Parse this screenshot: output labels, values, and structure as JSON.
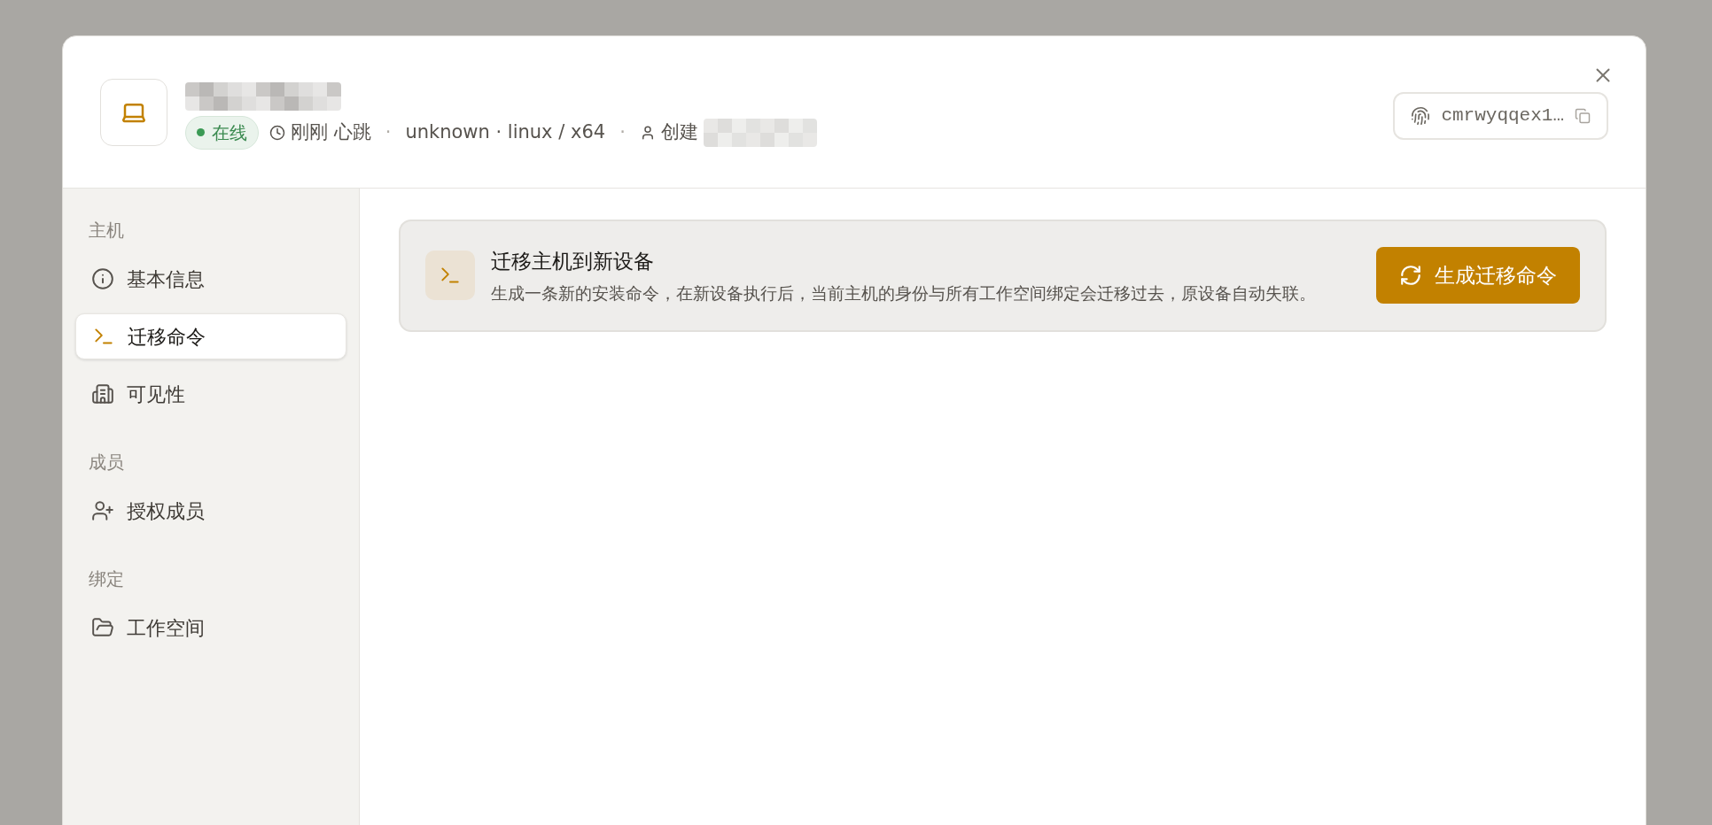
{
  "header": {
    "meta": [
      {
        "kind": "status",
        "text": "在线",
        "online": true
      },
      {
        "kind": "clock",
        "text": "刚刚 心跳"
      },
      {
        "kind": "sep",
        "text": "·"
      },
      {
        "kind": "plain",
        "text": "unknown · linux / x64"
      },
      {
        "kind": "sep",
        "text": "·"
      },
      {
        "kind": "user",
        "text": "创建"
      }
    ],
    "host_id": "cmrwyqqex1…"
  },
  "sidebar": {
    "groups": [
      {
        "label": "主机",
        "items": [
          {
            "kind": "info",
            "label": "基本信息",
            "selected": false
          },
          {
            "kind": "terminal",
            "label": "迁移命令",
            "selected": true
          },
          {
            "kind": "building",
            "label": "可见性",
            "selected": false
          }
        ]
      },
      {
        "label": "成员",
        "items": [
          {
            "kind": "user-plus",
            "label": "授权成员",
            "selected": false
          }
        ]
      },
      {
        "label": "绑定",
        "items": [
          {
            "kind": "folder",
            "label": "工作空间",
            "selected": false
          }
        ]
      }
    ]
  },
  "card": {
    "title": "迁移主机到新设备",
    "description": "生成一条新的安装命令，在新设备执行后，当前主机的身份与所有工作空间绑定会迁移过去，原设备自动失联。",
    "button": "生成迁移命令"
  }
}
